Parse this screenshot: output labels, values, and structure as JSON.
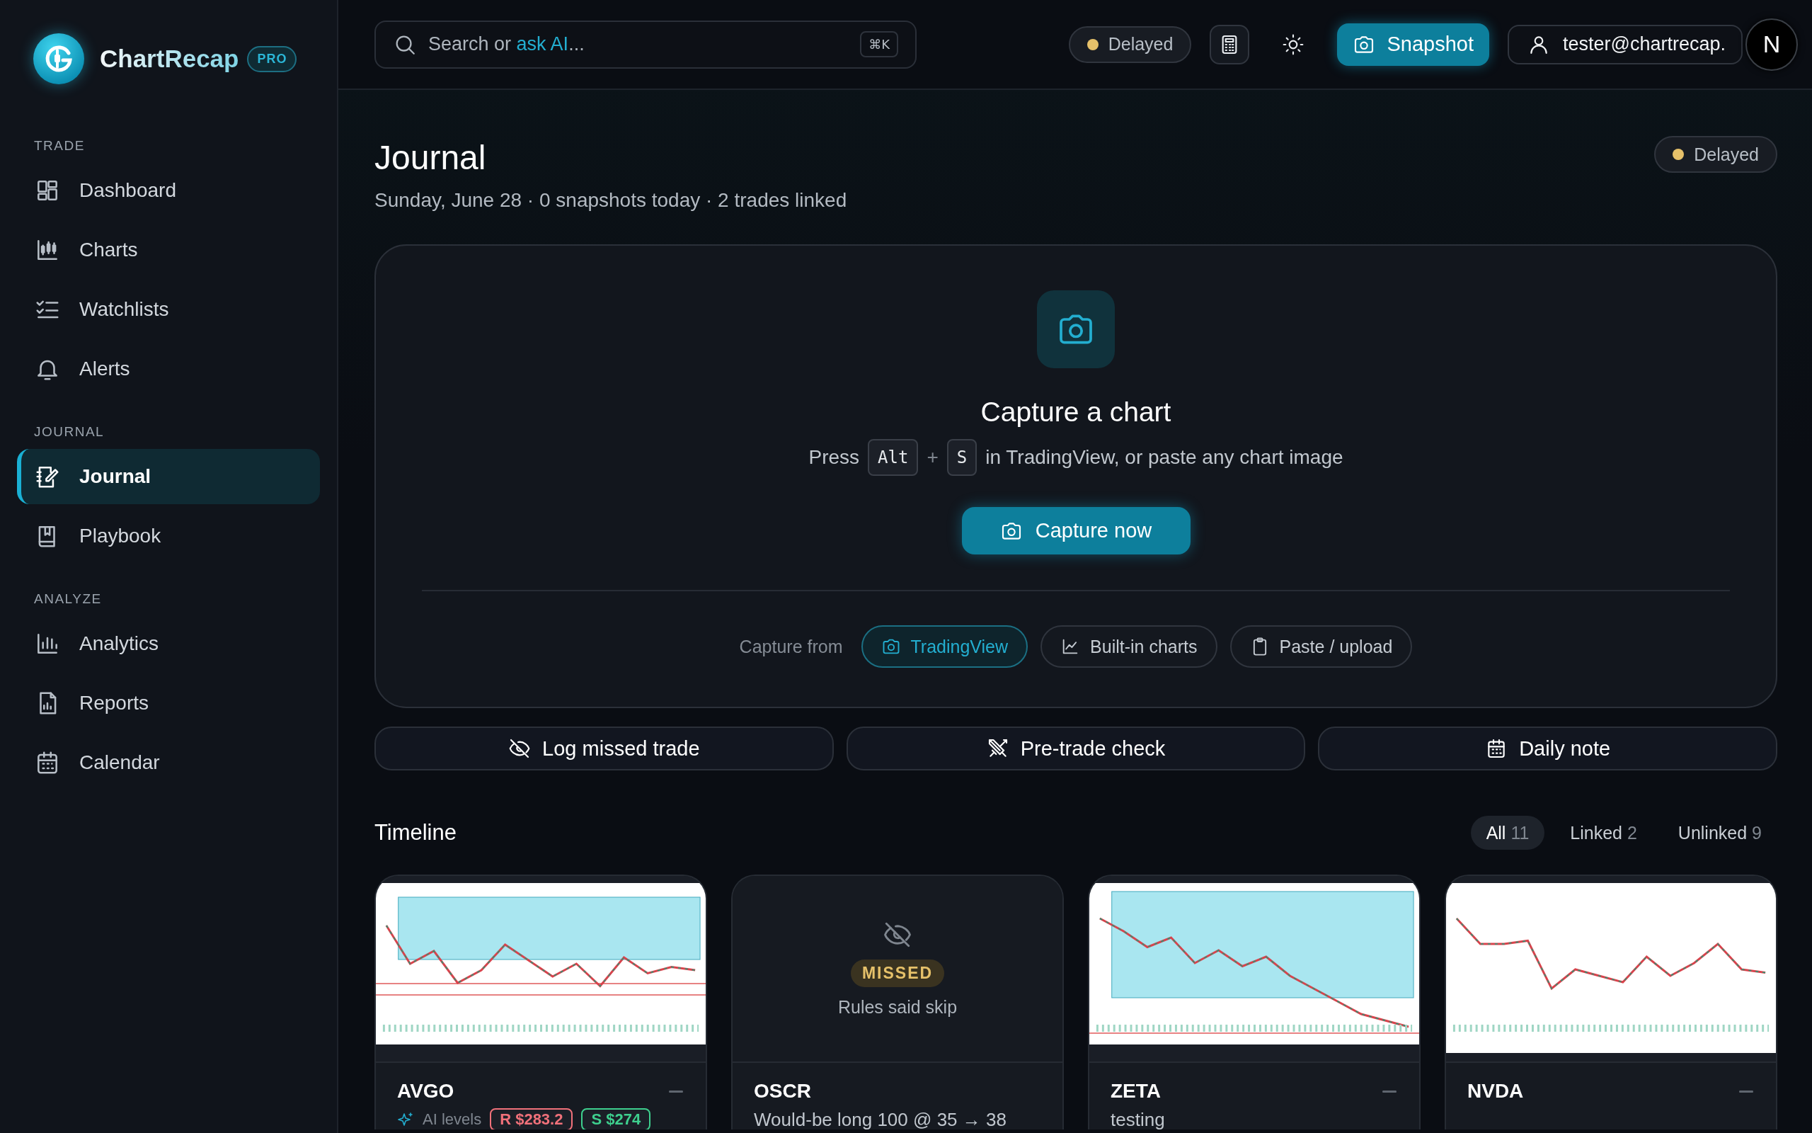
{
  "sidebar": {
    "brand": "ChartRecap",
    "badge": "PRO",
    "sections": [
      {
        "title": "TRADE",
        "items": [
          {
            "label": "Dashboard",
            "selected": false
          },
          {
            "label": "Charts",
            "selected": false
          },
          {
            "label": "Watchlists",
            "selected": false
          },
          {
            "label": "Alerts",
            "selected": false
          }
        ]
      },
      {
        "title": "JOURNAL",
        "items": [
          {
            "label": "Journal",
            "selected": true
          },
          {
            "label": "Playbook",
            "selected": false
          }
        ]
      },
      {
        "title": "ANALYZE",
        "items": [
          {
            "label": "Analytics",
            "selected": false
          },
          {
            "label": "Reports",
            "selected": false
          },
          {
            "label": "Calendar",
            "selected": false
          }
        ]
      }
    ]
  },
  "topbar": {
    "search": {
      "hint": [
        {
          "text": "Search or",
          "accent": false
        },
        {
          "text": "ask AI",
          "accent": true
        },
        {
          "text": "...",
          "accent": false
        }
      ],
      "shortcut": "⌘K"
    },
    "status": {
      "label": "Delayed",
      "color": "#e6c16a"
    },
    "snapshot_button": "Snapshot",
    "user": "tester@chartrecap.",
    "avatar": "N"
  },
  "page": {
    "title": "Journal",
    "subtitle": "Sunday, June 28 · 0 snapshots today · 2 trades linked",
    "status": {
      "label": "Delayed",
      "color": "#e6c16a"
    }
  },
  "capture": {
    "title": "Capture a chart",
    "hint_start": "Press",
    "keys": [
      "Alt",
      "S"
    ],
    "plus": "+",
    "hint_end": "in TradingView, or paste any chart image",
    "button": "Capture now",
    "source_label": "Capture from",
    "sources": [
      {
        "label": "TradingView",
        "selected": true
      },
      {
        "label": "Built-in charts",
        "selected": false
      },
      {
        "label": "Paste / upload",
        "selected": false
      }
    ]
  },
  "actions": [
    "Log missed trade",
    "Pre-trade check",
    "Daily note"
  ],
  "timeline": {
    "title": "Timeline",
    "filters": [
      {
        "label": "All",
        "count": "11",
        "selected": true
      },
      {
        "label": "Linked",
        "count": "2",
        "selected": false
      },
      {
        "label": "Unlinked",
        "count": "9",
        "selected": false
      }
    ],
    "cards": [
      {
        "kind": "snapshot",
        "symbol": "AVGO",
        "levels_label": "AI levels",
        "chips": [
          {
            "text": "R $283.2",
            "color": "#f0717a"
          },
          {
            "text": "S $274",
            "color": "#3ecf8e"
          }
        ]
      },
      {
        "kind": "missed",
        "badge": "MISSED",
        "reason": "Rules said skip",
        "symbol": "OSCR",
        "note": "Would-be long 100 @ 35 → 38"
      },
      {
        "kind": "snapshot",
        "symbol": "ZETA",
        "note": "testing"
      },
      {
        "kind": "snapshot",
        "symbol": "NVDA"
      }
    ]
  }
}
